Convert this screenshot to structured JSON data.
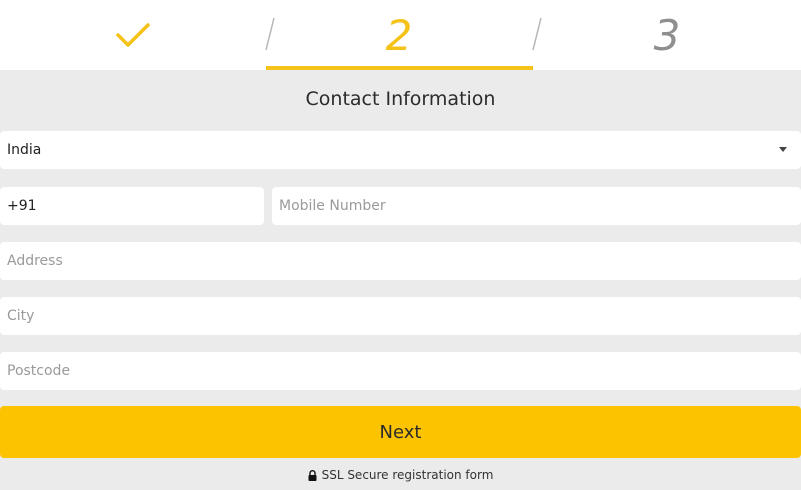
{
  "stepper": {
    "step1": {
      "state": "completed",
      "icon": "check-icon"
    },
    "step2": {
      "number": "2",
      "state": "active"
    },
    "step3": {
      "number": "3",
      "state": "upcoming"
    },
    "accent_color": "#f5c21a",
    "inactive_color": "#8f8f8f"
  },
  "form": {
    "title": "Contact Information",
    "country": {
      "value": "India"
    },
    "phone_code": {
      "value": "+91"
    },
    "mobile": {
      "placeholder": "Mobile Number",
      "value": ""
    },
    "address": {
      "placeholder": "Address",
      "value": ""
    },
    "city": {
      "placeholder": "City",
      "value": ""
    },
    "postcode": {
      "placeholder": "Postcode",
      "value": ""
    },
    "next_label": "Next",
    "button_color": "#fcc300"
  },
  "footer": {
    "ssl_text": "SSL Secure registration form",
    "icon": "lock-icon"
  }
}
